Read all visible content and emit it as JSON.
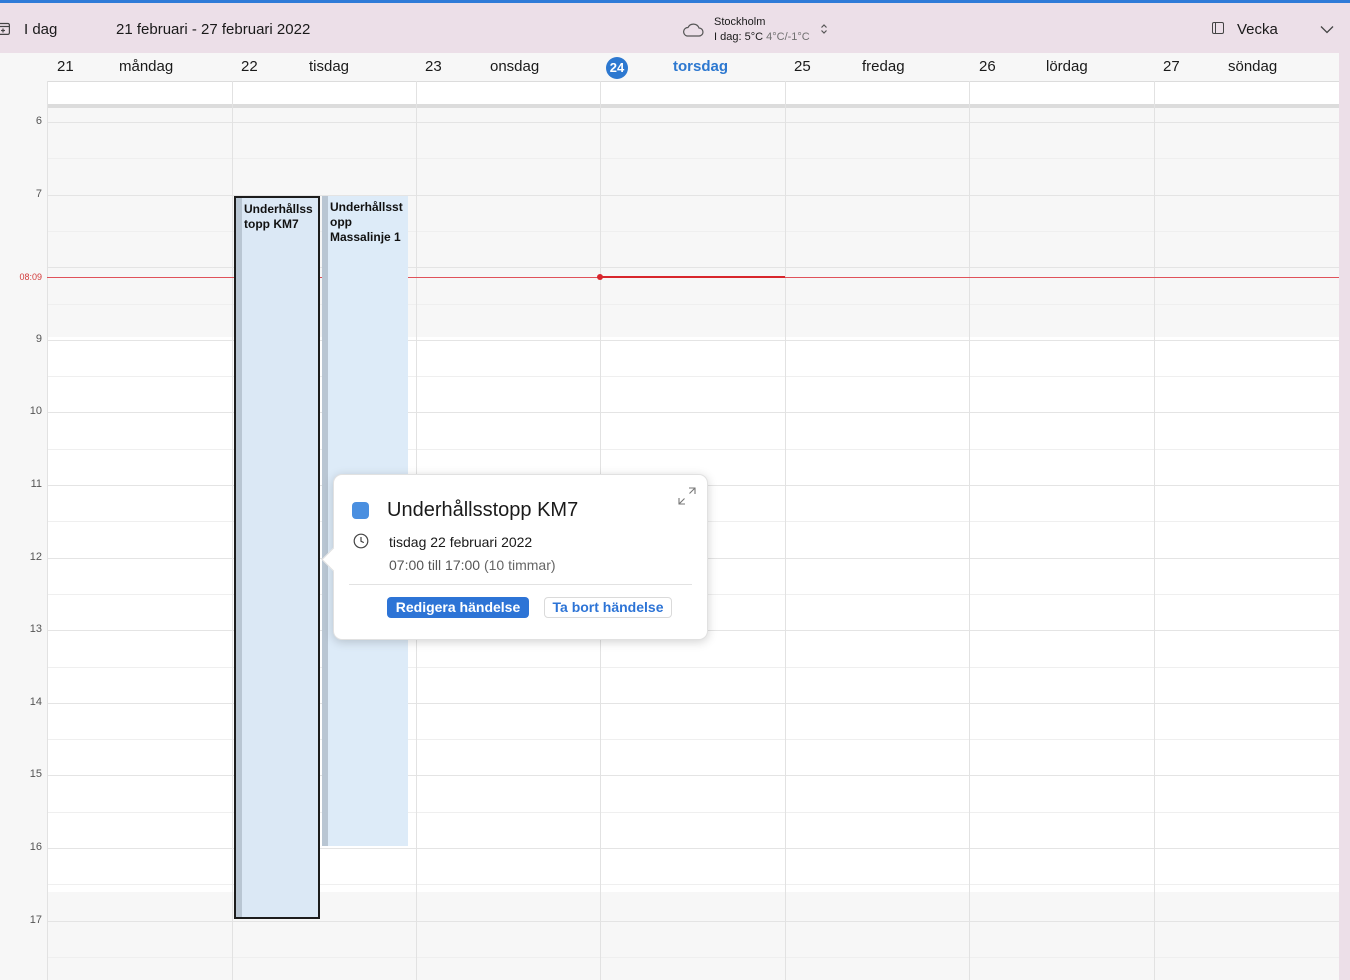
{
  "colors": {
    "accent": "#2d78d0",
    "now_line": "#d8262c",
    "event_fill": "#dbe8f5",
    "event_color_dot": "#4a8fe0"
  },
  "toolbar": {
    "today_label": "I dag",
    "date_range": "21 februari - 27 februari 2022",
    "view_label": "Vecka"
  },
  "weather": {
    "icon": "cloud-icon",
    "city": "Stockholm",
    "today_text": "I dag: 5°C",
    "temps": "4°C/-1°C"
  },
  "days": [
    {
      "num": "21",
      "name": "måndag"
    },
    {
      "num": "22",
      "name": "tisdag"
    },
    {
      "num": "23",
      "name": "onsdag"
    },
    {
      "num": "24",
      "name": "torsdag",
      "today": true
    },
    {
      "num": "25",
      "name": "fredag"
    },
    {
      "num": "26",
      "name": "lördag"
    },
    {
      "num": "27",
      "name": "söndag"
    }
  ],
  "hours": [
    "6",
    "7",
    "9",
    "10",
    "11",
    "12",
    "13",
    "14",
    "15",
    "16",
    "17"
  ],
  "now_time": "08:09",
  "events": [
    {
      "title": "Underhållss topp KM7",
      "day": "tisdag",
      "start": "07:00",
      "end": "17:00",
      "selected": true
    },
    {
      "title": "Underhållsst opp Massalinje 1",
      "day": "tisdag",
      "start": "07:00",
      "end": "16:00",
      "selected": false
    }
  ],
  "popover": {
    "title": "Underhållsstopp KM7",
    "date": "tisdag 22 februari 2022",
    "time": "07:00 till 17:00",
    "duration": "(10 timmar)",
    "edit_label": "Redigera händelse",
    "delete_label": "Ta bort händelse"
  }
}
